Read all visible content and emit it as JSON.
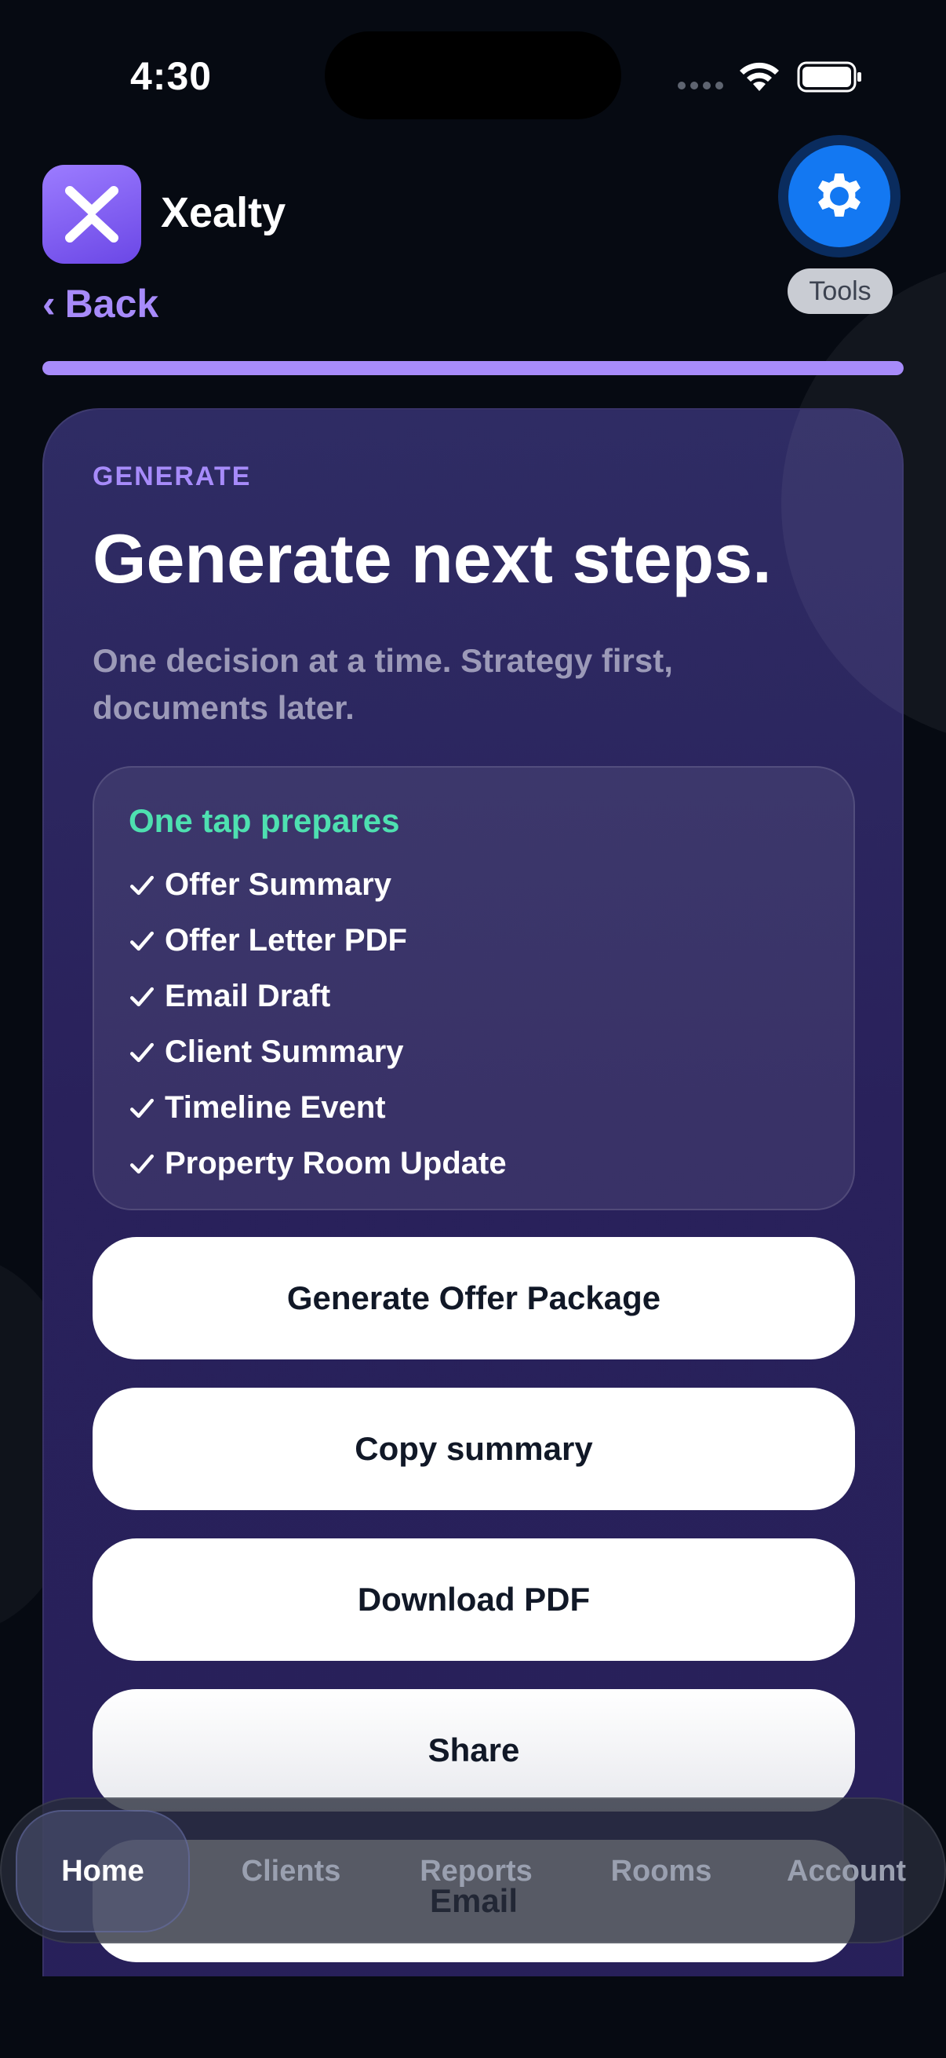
{
  "status_bar": {
    "time": "4:30"
  },
  "header": {
    "app_name": "Xealty",
    "back_label": "Back",
    "tools_label": "Tools",
    "progress_fraction": 1.0
  },
  "card": {
    "eyebrow": "GENERATE",
    "title": "Generate next steps.",
    "subtitle": "One decision at a time. Strategy first, documents later.",
    "prep_heading": "One tap prepares",
    "prep_items": [
      "Offer Summary",
      "Offer Letter PDF",
      "Email Draft",
      "Client Summary",
      "Timeline Event",
      "Property Room Update"
    ],
    "actions": {
      "generate": "Generate Offer Package",
      "copy": "Copy summary",
      "download": "Download PDF",
      "share": "Share",
      "email": "Email"
    }
  },
  "tab_bar": {
    "items": [
      "Home",
      "Clients",
      "Reports",
      "Rooms",
      "Account"
    ],
    "active": "Home"
  },
  "colors": {
    "accent": "#a78bfa",
    "success": "#4ee0b0",
    "tools_blue": "#1378f2",
    "background": "#060a12"
  },
  "icons": [
    "x-logo-icon",
    "gear-icon",
    "wifi-icon",
    "battery-icon",
    "check-icon",
    "chevron-left-icon"
  ]
}
